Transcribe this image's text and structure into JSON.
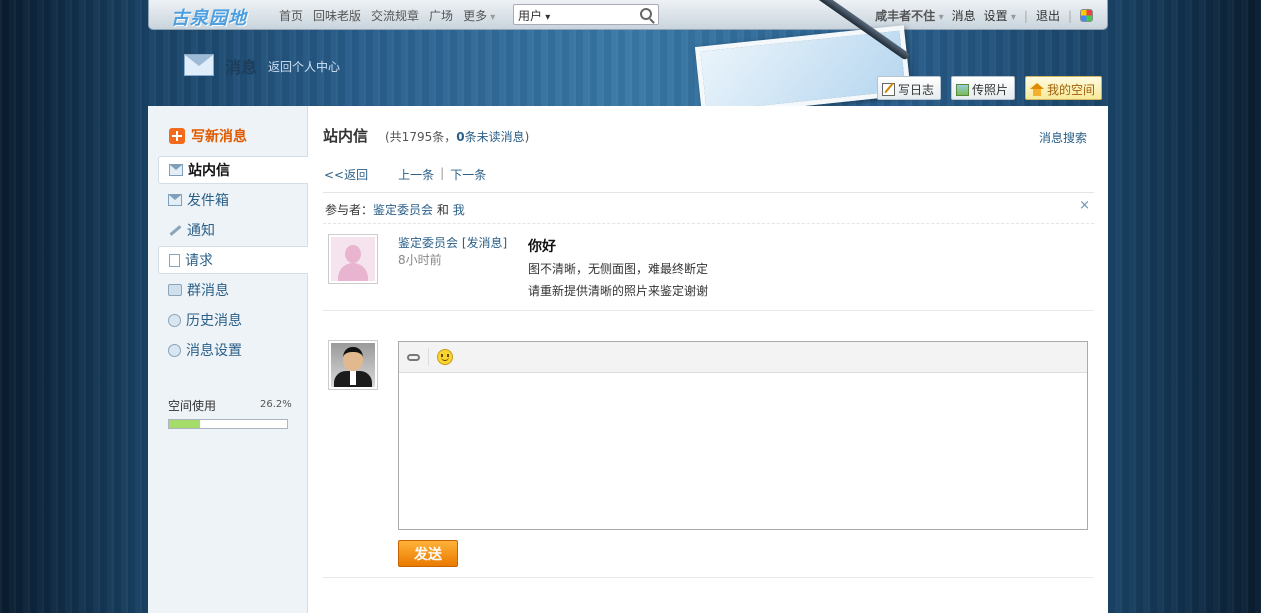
{
  "topbar": {
    "logo": "古泉园地",
    "nav": [
      "首页",
      "回味老版",
      "交流规章",
      "广场",
      "更多"
    ],
    "search_select": "用户",
    "username": "咸丰者不住",
    "messages": "消息",
    "settings": "设置",
    "logout": "退出"
  },
  "header": {
    "title": "消息",
    "back_link": "返回个人中心",
    "buttons": [
      "写日志",
      "传照片",
      "我的空间"
    ]
  },
  "sidebar": {
    "compose": "写新消息",
    "items": [
      "站内信",
      "发件箱",
      "通知",
      "请求",
      "群消息",
      "历史消息",
      "消息设置"
    ],
    "space_label": "空间使用",
    "space_pct": "26.2%",
    "space_fraction": 0.262
  },
  "main": {
    "title": "站内信",
    "count_prefix": "(共1795条，",
    "unread_num": "0",
    "unread_text": "条未读消息",
    "count_suffix": ")",
    "search": "消息搜索",
    "back": "<<返回",
    "prev": "上一条",
    "sep": "|",
    "next": "下一条",
    "participants_label": "参与者：",
    "participant1": "鉴定委员会",
    "and": "和",
    "participant2": "我",
    "close": "×"
  },
  "message": {
    "sender": "鉴定委员会 [发消息]",
    "time": "8小时前",
    "subject": "你好",
    "line1": "图不清晰，无侧面图，难最终断定",
    "line2": "请重新提供清晰的照片来鉴定谢谢"
  },
  "reply": {
    "textarea": "",
    "send": "发送"
  }
}
